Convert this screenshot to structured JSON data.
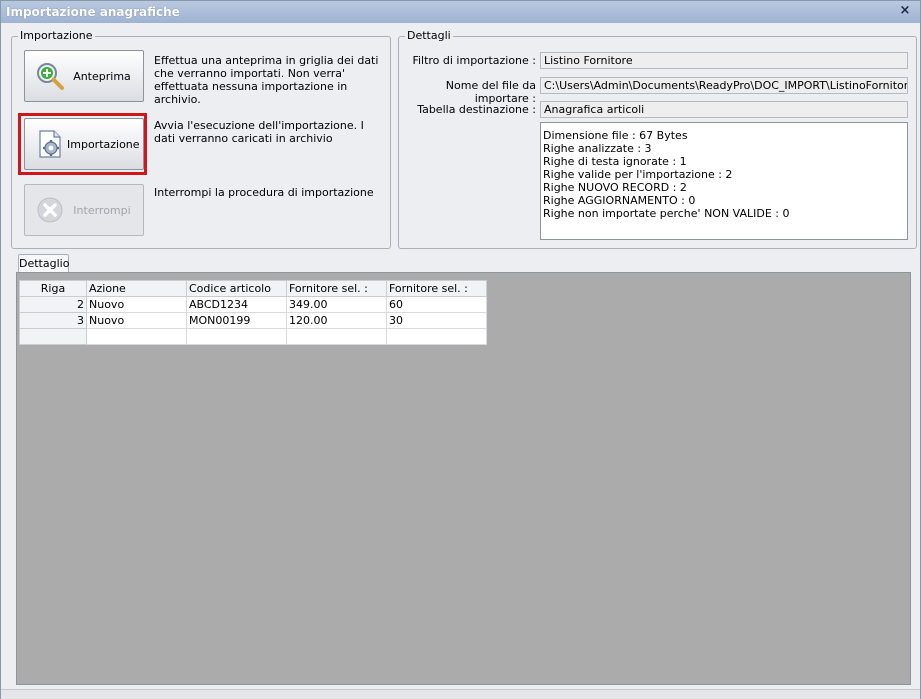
{
  "window": {
    "title": "Importazione anagrafiche",
    "close_glyph": "×"
  },
  "importazione": {
    "legend": "Importazione",
    "buttons": [
      {
        "label": "Anteprima",
        "icon": "magnifier-plus-icon",
        "description": "Effettua una anteprima in griglia dei dati che verranno importati. Non verra' effettuata nessuna importazione in archivio."
      },
      {
        "label": "Importazione",
        "icon": "document-gear-icon",
        "description": "Avvia l'esecuzione dell'importazione. I dati verranno caricati in archivio",
        "highlight_color": "#d0161b"
      },
      {
        "label": "Interrompi",
        "icon": "stop-x-icon",
        "description": "Interrompi la procedura di importazione",
        "disabled": true
      }
    ]
  },
  "dettagli": {
    "legend": "Dettagli",
    "filtro_label": "Filtro di importazione :",
    "filtro_value": "Listino Fornitore",
    "file_label": "Nome del file da importare :",
    "file_value": "C:\\Users\\Admin\\Documents\\ReadyPro\\DOC_IMPORT\\ListinoFornitore.txt",
    "tabella_label": "Tabella destinazione :",
    "tabella_value": "Anagrafica articoli",
    "summary_lines": [
      "Dimensione file : 67 Bytes",
      "Righe analizzate : 3",
      "Righe di testa ignorate : 1",
      "Righe valide per l'importazione : 2",
      "Righe NUOVO RECORD : 2",
      "Righe AGGIORNAMENTO  : 0",
      "Righe non importate perche' NON VALIDE : 0"
    ]
  },
  "tabs": [
    {
      "label": "Dettaglio"
    }
  ],
  "grid": {
    "headers": [
      "Riga",
      "Azione",
      "Codice articolo",
      "Fornitore sel. :",
      "Fornitore sel. :"
    ],
    "rows": [
      [
        "2",
        "Nuovo",
        "ABCD1234",
        "349.00",
        "60"
      ],
      [
        "3",
        "Nuovo",
        "MON00199",
        "120.00",
        "30"
      ]
    ]
  }
}
